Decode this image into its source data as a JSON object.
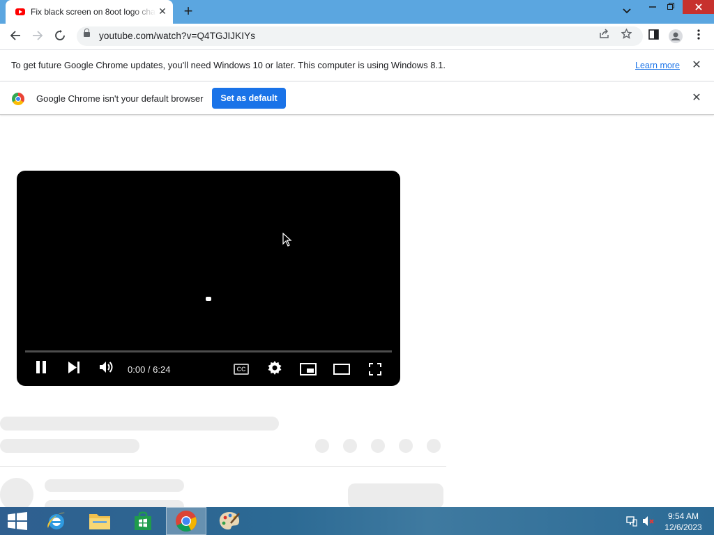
{
  "browser": {
    "tab_title": "Fix black screen on 8oot logo cha",
    "tab_close": "✕",
    "new_tab": "+",
    "address": "youtube.com/watch?v=Q4TGJIJKIYs"
  },
  "infobar_update": {
    "message": "To get future Google Chrome updates, you'll need Windows 10 or later. This computer is using Windows 8.1.",
    "link": "Learn more",
    "close": "✕"
  },
  "infobar_default": {
    "message": "Google Chrome isn't your default browser",
    "button": "Set as default",
    "close": "✕"
  },
  "player": {
    "time": "0:00 / 6:24",
    "cc_label": "CC",
    "progress_fraction": 0
  },
  "taskbar": {
    "time": "9:54 AM",
    "date": "12/6/2023"
  },
  "colors": {
    "titlebar": "#5ba6e0",
    "accent": "#1a73e8",
    "player_bg": "#000000",
    "skeleton": "#ececec"
  }
}
